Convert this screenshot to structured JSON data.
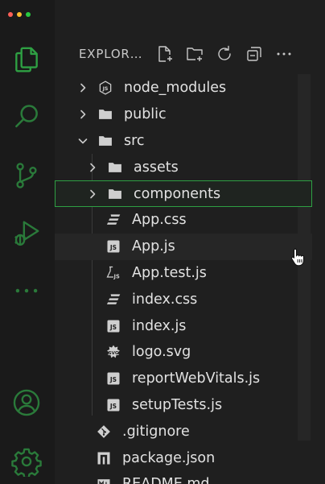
{
  "colors": {
    "accent": "#2ea043",
    "folder": "#d0d0d0",
    "file_icon": "#cfcfcf"
  },
  "window_controls": [
    {
      "name": "close",
      "color": "#ff5f57"
    },
    {
      "name": "minimize",
      "color": "#febc2e"
    },
    {
      "name": "maximize",
      "color": "#28c840"
    }
  ],
  "activity_bar": {
    "items": [
      {
        "icon": "files-icon",
        "active": true
      },
      {
        "icon": "search-icon"
      },
      {
        "icon": "source-control-icon"
      },
      {
        "icon": "run-debug-icon"
      },
      {
        "icon": "more-icon"
      },
      {
        "icon": "account-icon"
      },
      {
        "icon": "settings-gear-icon"
      }
    ]
  },
  "explorer": {
    "title": "EXPLOR…",
    "actions": [
      "new-file-icon",
      "new-folder-icon",
      "refresh-icon",
      "collapse-all-icon",
      "more-icon"
    ],
    "tree": [
      {
        "label": "node_modules",
        "type": "folder",
        "icon": "node-js-folder-icon",
        "depth": 0,
        "expanded": false
      },
      {
        "label": "public",
        "type": "folder",
        "icon": "folder-icon",
        "depth": 0,
        "expanded": false
      },
      {
        "label": "src",
        "type": "folder",
        "icon": "folder-icon",
        "depth": 0,
        "expanded": true
      },
      {
        "label": "assets",
        "type": "folder",
        "icon": "folder-icon",
        "depth": 1,
        "expanded": false
      },
      {
        "label": "components",
        "type": "folder",
        "icon": "folder-icon",
        "depth": 1,
        "expanded": false,
        "selected": true
      },
      {
        "label": "App.css",
        "type": "file",
        "icon": "css-icon",
        "depth": 1
      },
      {
        "label": "App.js",
        "type": "file",
        "icon": "js-icon",
        "depth": 1,
        "hovered": true
      },
      {
        "label": "App.test.js",
        "type": "file",
        "icon": "test-js-icon",
        "depth": 1
      },
      {
        "label": "index.css",
        "type": "file",
        "icon": "css-icon",
        "depth": 1
      },
      {
        "label": "index.js",
        "type": "file",
        "icon": "js-icon",
        "depth": 1
      },
      {
        "label": "logo.svg",
        "type": "file",
        "icon": "svg-icon",
        "depth": 1
      },
      {
        "label": "reportWebVitals.js",
        "type": "file",
        "icon": "js-icon",
        "depth": 1
      },
      {
        "label": "setupTests.js",
        "type": "file",
        "icon": "js-icon",
        "depth": 1
      },
      {
        "label": ".gitignore",
        "type": "file",
        "icon": "git-icon",
        "depth": 0
      },
      {
        "label": "package.json",
        "type": "file",
        "icon": "npm-icon",
        "depth": 0
      },
      {
        "label": "README.md",
        "type": "file",
        "icon": "readme-icon",
        "depth": 0
      }
    ]
  }
}
